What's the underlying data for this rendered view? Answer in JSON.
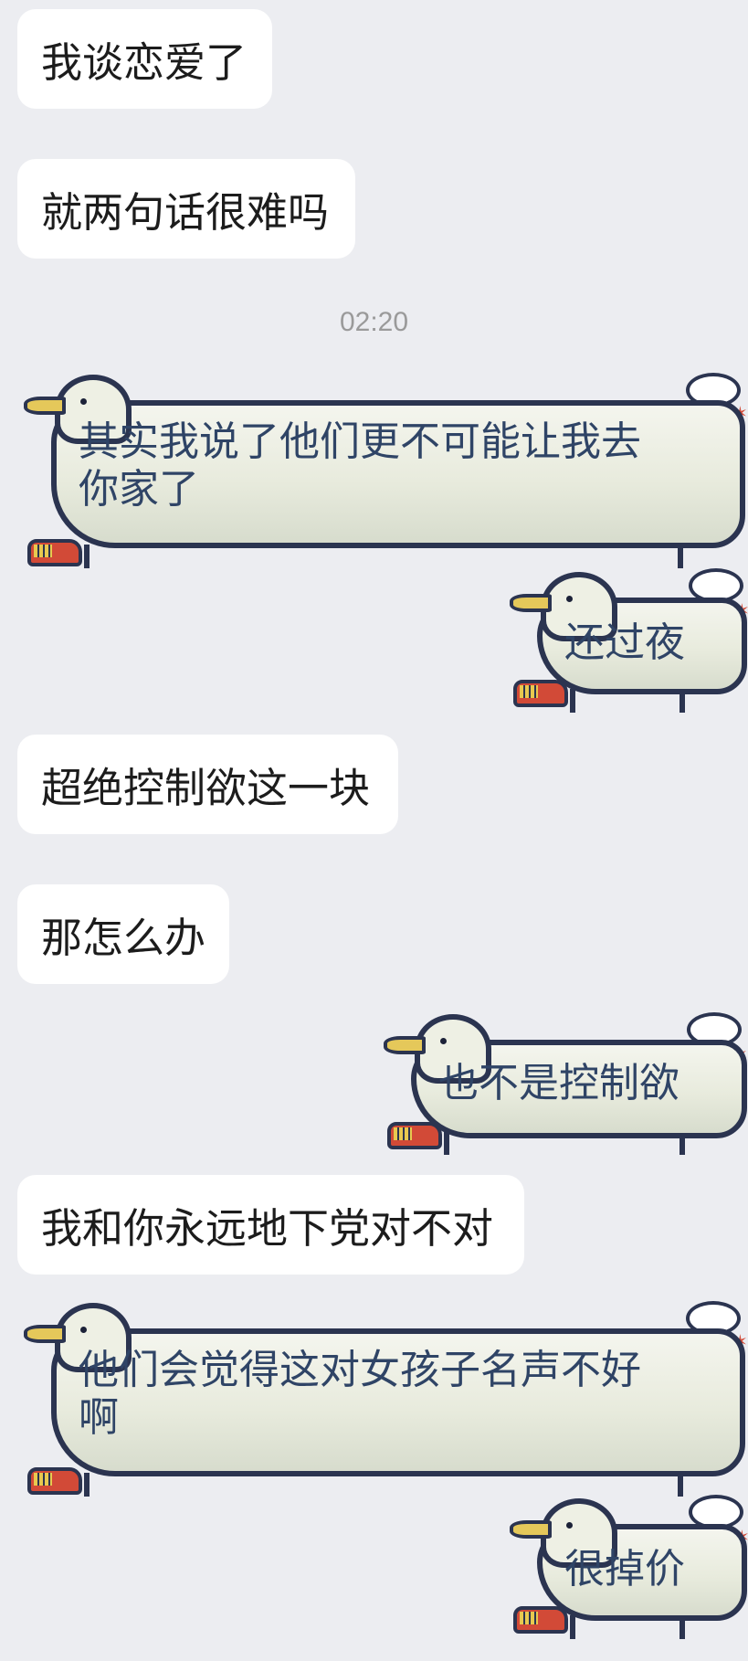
{
  "messages": [
    {
      "side": "left",
      "type": "text",
      "text": "我谈恋爱了"
    },
    {
      "side": "left",
      "type": "text",
      "text": "就两句话很难吗"
    },
    {
      "type": "timestamp",
      "text": "02:20"
    },
    {
      "side": "left",
      "type": "seagull",
      "line1": "其实我说了他们更不可能让我去",
      "line2": "你家了"
    },
    {
      "side": "right",
      "type": "seagull",
      "text": "还过夜"
    },
    {
      "side": "left",
      "type": "text",
      "text": "超绝控制欲这一块"
    },
    {
      "side": "left",
      "type": "text",
      "text": "那怎么办"
    },
    {
      "side": "right",
      "type": "seagull",
      "text": "也不是控制欲"
    },
    {
      "side": "left",
      "type": "text",
      "text": "我和你永远地下党对不对"
    },
    {
      "side": "left",
      "type": "seagull",
      "line1": "他们会觉得这对女孩子名声不好",
      "line2": "啊"
    },
    {
      "side": "right",
      "type": "seagull",
      "text": "很掉价"
    }
  ],
  "colors": {
    "background": "#ecedf1",
    "bubble": "#ffffff",
    "seagull_text": "#2f4466",
    "outline": "#2b3450"
  }
}
